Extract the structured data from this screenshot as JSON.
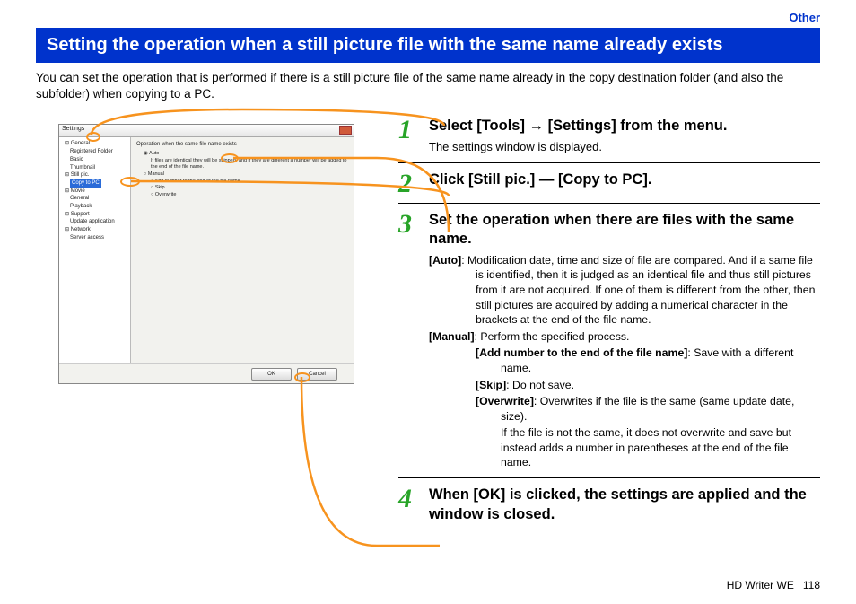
{
  "breadcrumb": "Other",
  "title": "Setting the operation when a still picture file with the same name already exists",
  "intro": "You can set the operation that is performed if there is a still picture file of the same name already in the copy destination folder (and also the subfolder) when copying to a PC.",
  "screenshot": {
    "window_title": "Settings",
    "tree": {
      "n0": "General",
      "n0a": "Registered Folder",
      "n0b": "Basic",
      "n0c": "Thumbnail",
      "n1": "Still pic.",
      "n1a": "Copy to PC",
      "n2": "Movie",
      "n2a": "General",
      "n2b": "Playback",
      "n3": "Support",
      "n3a": "Update application",
      "n4": "Network",
      "n4a": "Server access"
    },
    "panel": {
      "group_title": "Operation when the same file name exists",
      "opt_auto": "Auto",
      "auto_note": "If files are identical they will be skipped, and if they are different a number will be added to the end of the file name.",
      "opt_manual": "Manual",
      "m_add": "Add number to the end of the file name",
      "m_skip": "Skip",
      "m_over": "Overwrite"
    },
    "ok": "OK",
    "cancel": "Cancel"
  },
  "steps": {
    "s1": {
      "num": "1",
      "title": "Select [Tools] → [Settings] from the menu.",
      "sub": "The settings window is displayed."
    },
    "s2": {
      "num": "2",
      "title": "Click [Still pic.] — [Copy to PC]."
    },
    "s3": {
      "num": "3",
      "title": "Set the operation when there are files with the same name.",
      "auto_label": "[Auto]",
      "auto_text": ": Modification date, time and size of file are compared. And if a same file is identified, then it is judged as an identical file and thus still pictures from it are not acquired. If one of them is different from the other, then still pictures are acquired by adding a numerical character in the brackets at the end of the file name.",
      "manual_label": "[Manual]",
      "manual_text": ": Perform the specified process.",
      "add_label": "[Add number to the end of the file name]",
      "add_text": ": Save with a different name.",
      "skip_label": "[Skip]",
      "skip_text": ": Do not save.",
      "over_label": "[Overwrite]",
      "over_text": ": Overwrites if the file is the same (same update date, size).",
      "over_cont": "If the file is not the same, it does not overwrite and save but instead adds a number in parentheses at the end of the file name."
    },
    "s4": {
      "num": "4",
      "title": "When [OK] is clicked, the settings are applied and the window is closed."
    }
  },
  "footer": {
    "product": "HD Writer WE",
    "page": "118"
  }
}
